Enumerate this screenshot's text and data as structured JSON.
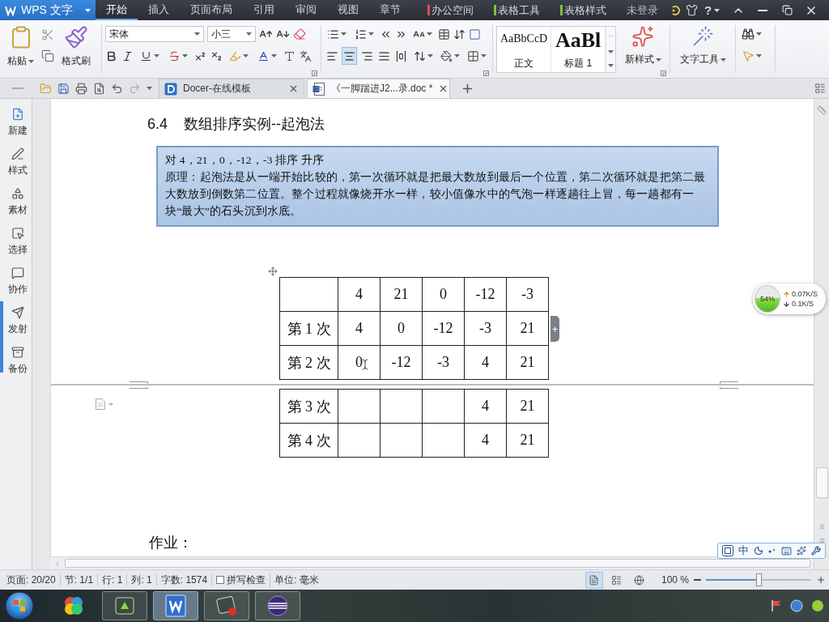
{
  "app_menu": {
    "label": "WPS 文字"
  },
  "menu_tabs": [
    {
      "label": "开始",
      "selected": true
    },
    {
      "label": "插入",
      "selected": false
    },
    {
      "label": "页面布局",
      "selected": false
    },
    {
      "label": "引用",
      "selected": false
    },
    {
      "label": "审阅",
      "selected": false
    },
    {
      "label": "视图",
      "selected": false
    },
    {
      "label": "章节",
      "selected": false
    }
  ],
  "context_tabs": [
    {
      "label": "办公空间",
      "color": "#d9534f"
    },
    {
      "label": "表格工具",
      "color": "#7ac143"
    },
    {
      "label": "表格样式",
      "color": "#7ac143"
    }
  ],
  "account": "未登录",
  "help": "?",
  "ribbon": {
    "paste": "粘贴",
    "format_painter": "格式刷",
    "font_name": "宋体",
    "font_size": "小三",
    "alignment": [
      {
        "kind": "left",
        "selected": false
      },
      {
        "kind": "center",
        "selected": true
      },
      {
        "kind": "right",
        "selected": false
      },
      {
        "kind": "justify",
        "selected": false
      },
      {
        "kind": "distributed",
        "selected": false
      }
    ],
    "styles": [
      {
        "sample": "AaBbCcD",
        "label": "正文",
        "kind": "body"
      },
      {
        "sample": "AaBl",
        "label": "标题 1",
        "kind": "heading"
      }
    ],
    "new_style": "新样式",
    "text_tools": "文字工具"
  },
  "doc_tabs": [
    {
      "label": "Docer-在线模板",
      "kind": "docer",
      "selected": false
    },
    {
      "label": "《一脚踹进J2...录.doc *",
      "kind": "doc",
      "selected": true
    }
  ],
  "sidebar": [
    {
      "label": "新建",
      "kind": "new"
    },
    {
      "label": "样式",
      "kind": "style"
    },
    {
      "label": "素材",
      "kind": "material"
    },
    {
      "label": "选择",
      "kind": "select"
    },
    {
      "label": "协作",
      "kind": "collab"
    },
    {
      "label": "发射",
      "kind": "launch"
    },
    {
      "label": "备份",
      "kind": "backup"
    }
  ],
  "document": {
    "heading": {
      "number": "6.4",
      "title": "数组排序实例--起泡法"
    },
    "note": {
      "task": "对  4，21，0，-12，-3 排序 升序",
      "principle": "原理：起泡法是从一端开始比较的，第一次循环就是把最大数放到最后一个位置，第二次循环就是把第二最大数放到倒数第二位置。整个过程就像烧开水一样，较小值像水中的气泡一样逐趟往上冒，每一趟都有一块“最大”的石头沉到水底。"
    },
    "table": {
      "header": [
        "4",
        "21",
        "0",
        "-12",
        "-3"
      ],
      "rows": [
        {
          "label": "第 1 次",
          "cells": [
            "4",
            "0",
            "-12",
            "-3",
            "21"
          ]
        },
        {
          "label": "第 2 次",
          "cells": [
            "0",
            "-12",
            "-3",
            "4",
            "21"
          ]
        }
      ],
      "continued_rows": [
        {
          "label": "第 3 次",
          "cells": [
            null,
            null,
            null,
            "4",
            "21"
          ]
        },
        {
          "label": "第 4 次",
          "cells": [
            null,
            null,
            null,
            "4",
            "21"
          ]
        }
      ]
    },
    "homework": "作业："
  },
  "network_widget": {
    "percent": "54%",
    "level": 0.54,
    "upload": "0.07K/S",
    "download": "0.1K/S"
  },
  "ime_toolbar": {
    "mode": "中"
  },
  "status_bar": {
    "items": [
      "页面: 20/20",
      "节: 1/1",
      "行: 1",
      "列: 1",
      "字数: 1574"
    ],
    "spell_check": {
      "label": "拼写检查",
      "checked": false
    },
    "unit": "单位: 毫米",
    "views": [
      {
        "kind": "page",
        "selected": true
      },
      {
        "kind": "outline",
        "selected": false
      },
      {
        "kind": "web",
        "selected": false
      }
    ],
    "zoom": {
      "label": "100 %",
      "level": 0.5
    }
  },
  "taskbar": {
    "apps": [
      {
        "kind": "colors",
        "running": false,
        "selected": false
      },
      {
        "kind": "runner",
        "running": true,
        "selected": false
      },
      {
        "kind": "wps",
        "running": true,
        "selected": true
      },
      {
        "kind": "tool",
        "running": true,
        "selected": false
      },
      {
        "kind": "eclipse",
        "running": true,
        "selected": false
      }
    ]
  }
}
